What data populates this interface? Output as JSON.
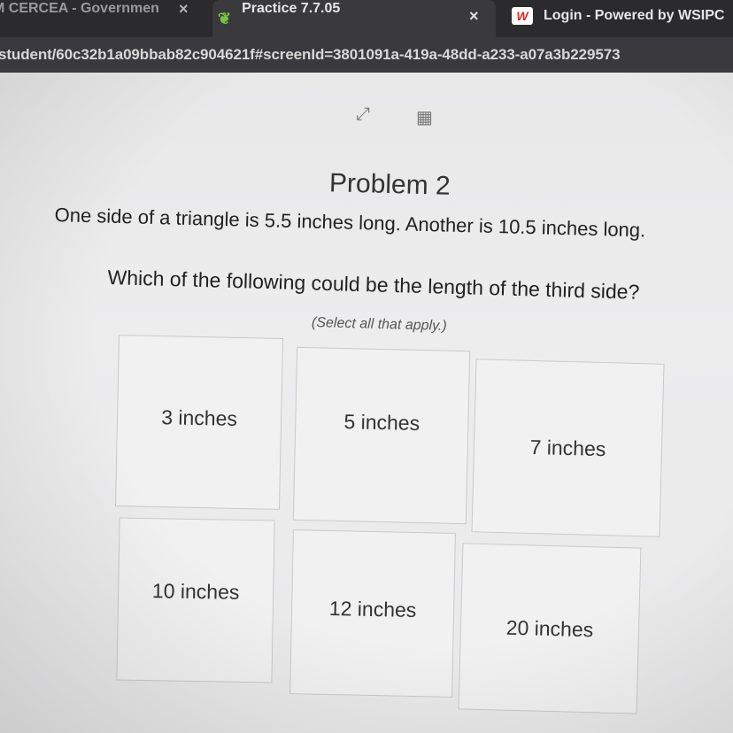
{
  "browser": {
    "tabs": [
      {
        "title": "M CERCEA - Governmen",
        "close": "×"
      },
      {
        "title": "Practice 7.7.05",
        "close": "×",
        "favicon": "plant-icon"
      },
      {
        "title": "Login - Powered by WSIPC",
        "favicon_letter": "W"
      }
    ],
    "url": "student/60c32b1a09bbab82c904621f#screenId=3801091a-419a-48dd-a233-a07a3b229573"
  },
  "toolbar": {
    "expand_glyph": "⤢",
    "calculator_glyph": "▦"
  },
  "problem": {
    "title": "Problem 2",
    "prompt": "One side of a triangle is 5.5 inches long. Another is 10.5 inches long.",
    "question": "Which of the following could be the length of the third side?",
    "instructions": "(Select all that apply.)",
    "choices": [
      {
        "label": "3 inches"
      },
      {
        "label": "5 inches"
      },
      {
        "label": "7 inches"
      },
      {
        "label": "10 inches"
      },
      {
        "label": "12 inches"
      },
      {
        "label": "20 inches"
      }
    ]
  }
}
